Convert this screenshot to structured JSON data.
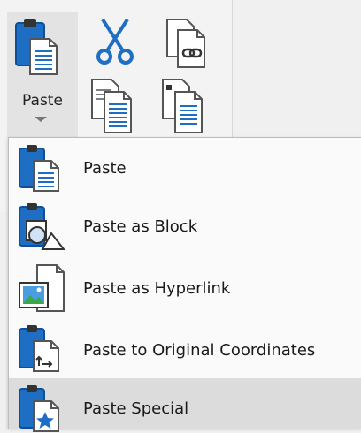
{
  "ribbon": {
    "paste_label": "Paste",
    "buttons": [
      {
        "icon": "paste-icon"
      },
      {
        "icon": "cut-icon"
      },
      {
        "icon": "copy-link-icon"
      },
      {
        "icon": "copy-icon"
      },
      {
        "icon": "copy-basepoint-icon"
      }
    ]
  },
  "menu": {
    "items": [
      {
        "label": "Paste",
        "icon": "paste-icon"
      },
      {
        "label": "Paste as Block",
        "icon": "paste-block-icon"
      },
      {
        "label": "Paste as Hyperlink",
        "icon": "paste-hyperlink-icon"
      },
      {
        "label": "Paste to Original Coordinates",
        "icon": "paste-original-coords-icon"
      },
      {
        "label": "Paste Special",
        "icon": "paste-special-icon",
        "highlighted": true
      }
    ]
  },
  "colors": {
    "clipboard_blue": "#1e6fc4",
    "clipboard_dark": "#0f4f99",
    "highlight": "#dcdcdc"
  }
}
